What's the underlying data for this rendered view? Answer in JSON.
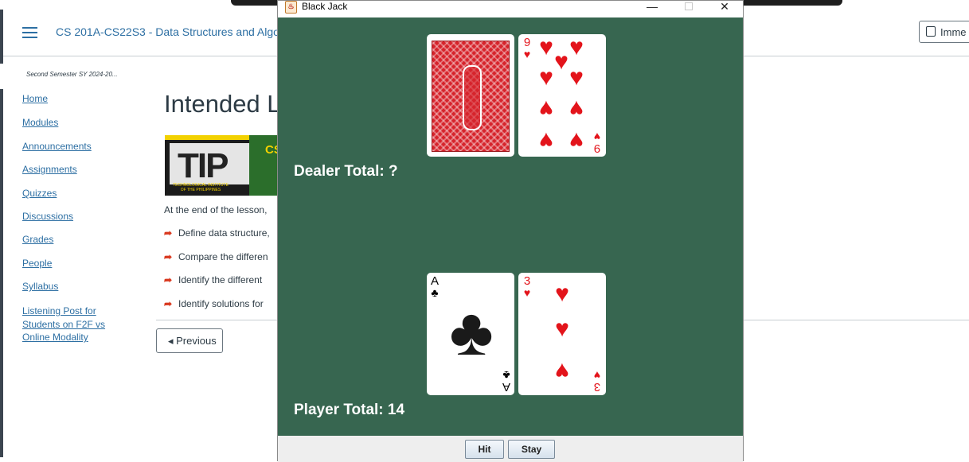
{
  "canvas": {
    "course_title": "CS 201A-CS22S3 - Data Structures and Algo...",
    "immersive_label": "Imme",
    "term": "Second Semester SY 2024-20...",
    "nav_items": [
      {
        "label": "Home"
      },
      {
        "label": "Modules"
      },
      {
        "label": "Announcements"
      },
      {
        "label": "Assignments"
      },
      {
        "label": "Quizzes"
      },
      {
        "label": "Discussions"
      },
      {
        "label": "Grades"
      },
      {
        "label": "People"
      },
      {
        "label": "Syllabus"
      },
      {
        "label": "Listening Post for Students on F2F vs Online Modality"
      }
    ],
    "page_heading": "Intended L",
    "logo": {
      "letters": "TIP",
      "subtitle": "TECHNOLOGICAL INSTITUTE OF THE PHILIPPINES",
      "badge": "CS"
    },
    "intro": "At the end of the lesson, ",
    "objectives": [
      "Define data structure,",
      "Compare the differen",
      "Identify the different",
      "Identify solutions for"
    ],
    "previous_label": "◂ Previous"
  },
  "blackjack": {
    "window_title": "Black Jack",
    "java_icon_glyph": "♨",
    "minimize_glyph": "—",
    "close_glyph": "✕",
    "dealer_total": "Dealer Total: ?",
    "player_total": "Player Total: 14",
    "dealer_cards": [
      {
        "face_down": true
      },
      {
        "rank": "9",
        "suit": "♥",
        "color": "#e3141b"
      }
    ],
    "player_cards": [
      {
        "rank": "A",
        "suit": "♣",
        "color": "#000000"
      },
      {
        "rank": "3",
        "suit": "♥",
        "color": "#e3141b"
      }
    ],
    "buttons": {
      "hit": "Hit",
      "stay": "Stay"
    },
    "table_color": "#376650"
  }
}
